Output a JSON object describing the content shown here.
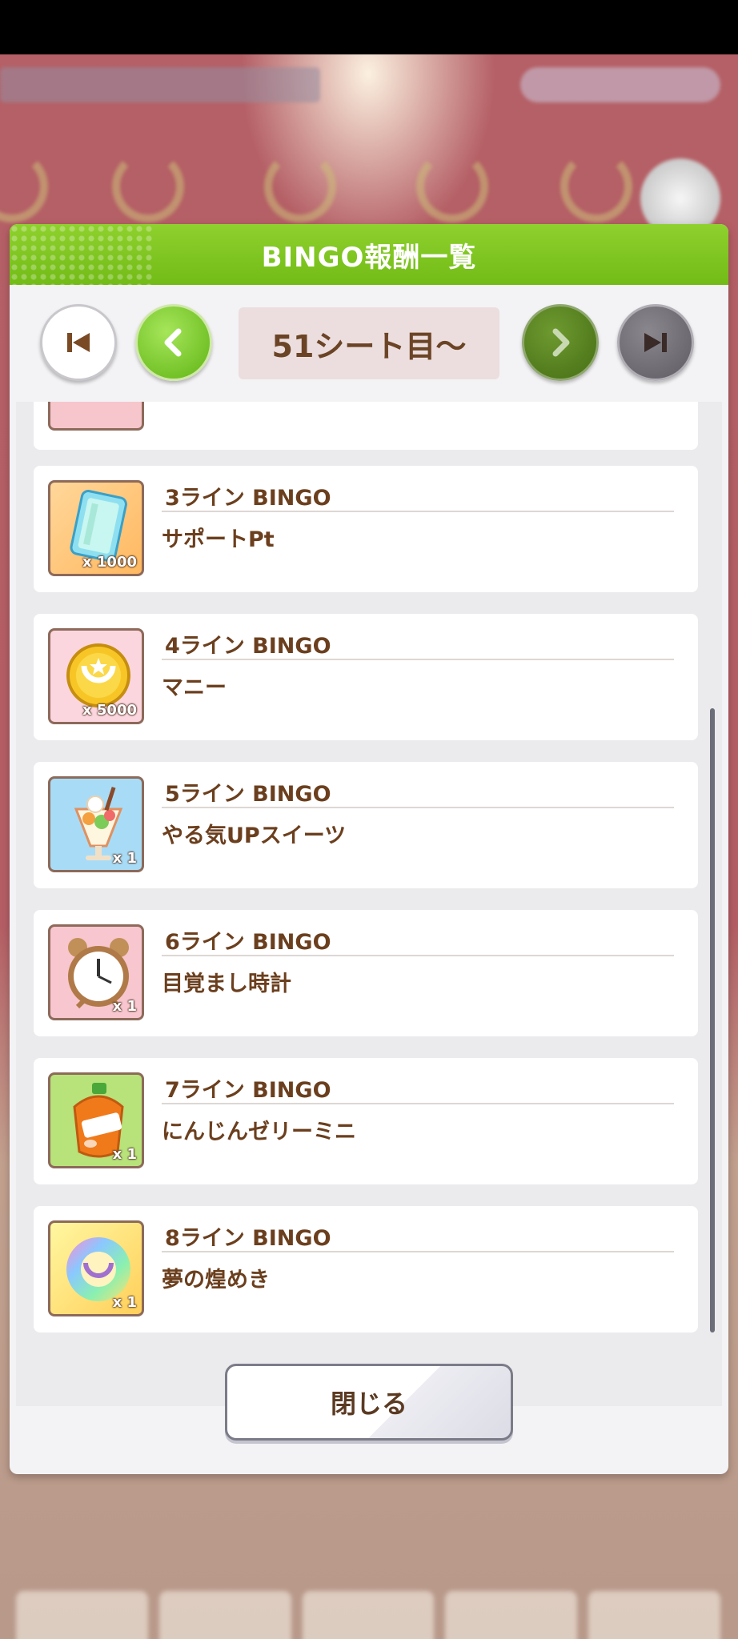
{
  "dialog": {
    "title": "BINGO報酬一覧",
    "sheet_label": "51シート目～",
    "close_label": "閉じる"
  },
  "colors": {
    "header_green": "#7dc420",
    "text_brown": "#6b3f1e",
    "prev_green": "#5fb414",
    "next_dark_green": "#456e14"
  },
  "rewards": [
    {
      "line": "3ライン BINGO",
      "name": "サポートPt",
      "qty": "x 1000",
      "icon": "support-pt-card-icon"
    },
    {
      "line": "4ライン BINGO",
      "name": "マニー",
      "qty": "x 5000",
      "icon": "money-coin-icon"
    },
    {
      "line": "5ライン BINGO",
      "name": "やる気UPスイーツ",
      "qty": "x 1",
      "icon": "parfait-icon"
    },
    {
      "line": "6ライン BINGO",
      "name": "目覚まし時計",
      "qty": "x 1",
      "icon": "alarm-clock-icon"
    },
    {
      "line": "7ライン BINGO",
      "name": "にんじんゼリーミニ",
      "qty": "x 1",
      "icon": "carrot-jelly-icon"
    },
    {
      "line": "8ライン BINGO",
      "name": "夢の煌めき",
      "qty": "x 1",
      "icon": "dream-horseshoe-icon"
    }
  ]
}
